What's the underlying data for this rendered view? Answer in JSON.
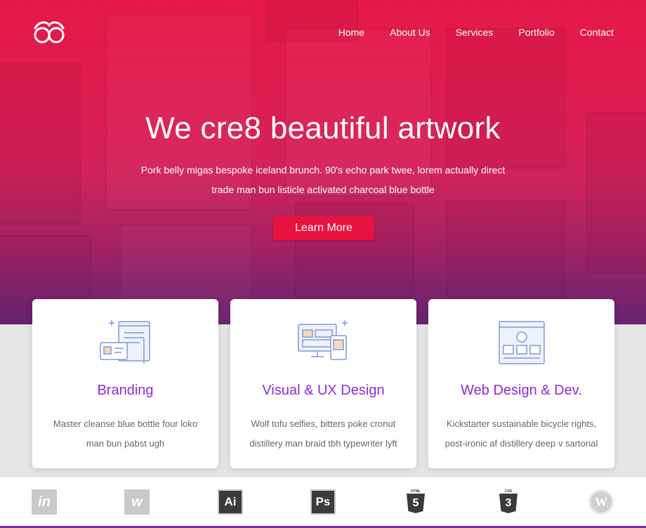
{
  "brand": {
    "logo_icon": "infinity-eyes-logo"
  },
  "nav": {
    "items": [
      {
        "label": "Home"
      },
      {
        "label": "About Us"
      },
      {
        "label": "Services"
      },
      {
        "label": "Portfolio"
      },
      {
        "label": "Contact"
      }
    ]
  },
  "hero": {
    "title": "We cre8 beautiful artwork",
    "subtitle_line1": "Pork belly migas bespoke iceland brunch. 90's echo park twee, lorem actually direct",
    "subtitle_line2": "trade man bun listicle activated charcoal blue bottle",
    "cta_label": "Learn More"
  },
  "services": [
    {
      "title": "Branding",
      "icon": "branding-icon",
      "line1": "Master cleanse blue bottle four loko",
      "line2": "man bun pabst ugh"
    },
    {
      "title": "Visual & UX Design",
      "icon": "devices-icon",
      "line1": "Wolf tofu selfies, bitters poke cronut",
      "line2": "distillery man braid tbh typewriter lyft"
    },
    {
      "title": "Web Design & Dev.",
      "icon": "web-layout-icon",
      "line1": "Kickstarter sustainable bicycle rights,",
      "line2": "post-ironic af distillery deep v sartorial"
    }
  ],
  "tools": [
    {
      "name": "invision-icon",
      "label": "in"
    },
    {
      "name": "webflow-icon",
      "label": "w"
    },
    {
      "name": "illustrator-icon",
      "label": "Ai"
    },
    {
      "name": "photoshop-icon",
      "label": "Ps"
    },
    {
      "name": "html5-icon",
      "label": "5"
    },
    {
      "name": "css3-icon",
      "label": "3"
    },
    {
      "name": "wordpress-icon",
      "label": "W"
    }
  ],
  "colors": {
    "accent": "#e8123f",
    "purple": "#8e2ad6",
    "bar": "#7b2ba8"
  }
}
